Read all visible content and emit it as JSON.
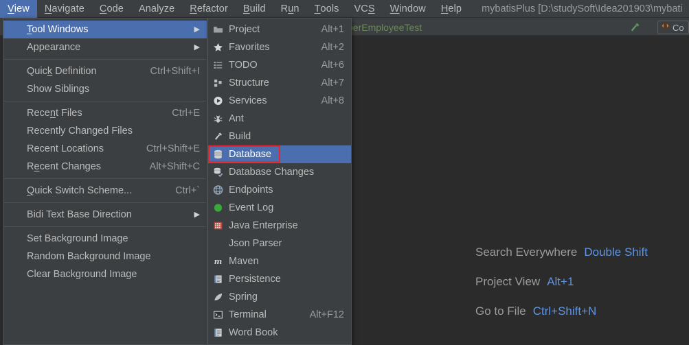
{
  "window": {
    "title": "mybatisPlus [D:\\studySoft\\Idea201903\\mybati",
    "accent_highlight": "#4b6eaf",
    "background": "#2b2b2b",
    "menu_background": "#3c3f41",
    "annotation_color": "#e8232a"
  },
  "menubar": {
    "items": [
      {
        "label": "View",
        "mnemonic": "V",
        "active": true
      },
      {
        "label": "Navigate",
        "mnemonic": "N",
        "active": false
      },
      {
        "label": "Code",
        "mnemonic": "C",
        "active": false
      },
      {
        "label": "Analyze",
        "mnemonic": "",
        "active": false
      },
      {
        "label": "Refactor",
        "mnemonic": "R",
        "active": false
      },
      {
        "label": "Build",
        "mnemonic": "B",
        "active": false
      },
      {
        "label": "Run",
        "mnemonic": "u",
        "active": false
      },
      {
        "label": "Tools",
        "mnemonic": "T",
        "active": false
      },
      {
        "label": "VCS",
        "mnemonic": "S",
        "active": false
      },
      {
        "label": "Window",
        "mnemonic": "W",
        "active": false
      },
      {
        "label": "Help",
        "mnemonic": "H",
        "active": false
      }
    ]
  },
  "editor": {
    "tab_label": "perEmployeeTest",
    "build_icon": "hammer-icon",
    "run_config_label": "Co",
    "run_config_icon": "run-config-icon"
  },
  "tips": [
    {
      "name": "Search Everywhere",
      "key": "Double Shift"
    },
    {
      "name": "Project View",
      "key": "Alt+1"
    },
    {
      "name": "Go to File",
      "key": "Ctrl+Shift+N"
    }
  ],
  "view_menu": {
    "items": [
      {
        "label": "Tool Windows",
        "mnemonic": "T",
        "accel": "",
        "submenu": true,
        "selected": true
      },
      {
        "label": "Appearance",
        "mnemonic": "",
        "accel": "",
        "submenu": true,
        "selected": false
      },
      {
        "separator": true
      },
      {
        "label": "Quick Definition",
        "mnemonic": "k",
        "accel": "Ctrl+Shift+I",
        "submenu": false,
        "selected": false
      },
      {
        "label": "Show Siblings",
        "mnemonic": "",
        "accel": "",
        "submenu": false,
        "selected": false
      },
      {
        "separator": true
      },
      {
        "label": "Recent Files",
        "mnemonic": "n",
        "accel": "Ctrl+E",
        "submenu": false,
        "selected": false
      },
      {
        "label": "Recently Changed Files",
        "mnemonic": "",
        "accel": "",
        "submenu": false,
        "selected": false
      },
      {
        "label": "Recent Locations",
        "mnemonic": "",
        "accel": "Ctrl+Shift+E",
        "submenu": false,
        "selected": false
      },
      {
        "label": "Recent Changes",
        "mnemonic": "e",
        "accel": "Alt+Shift+C",
        "submenu": false,
        "selected": false
      },
      {
        "separator": true
      },
      {
        "label": "Quick Switch Scheme...",
        "mnemonic": "Q",
        "accel": "Ctrl+`",
        "submenu": false,
        "selected": false
      },
      {
        "separator": true
      },
      {
        "label": "Bidi Text Base Direction",
        "mnemonic": "",
        "accel": "",
        "submenu": true,
        "selected": false
      },
      {
        "separator": true
      },
      {
        "label": "Set Background Image",
        "mnemonic": "",
        "accel": "",
        "submenu": false,
        "selected": false
      },
      {
        "label": "Random Background Image",
        "mnemonic": "",
        "accel": "",
        "submenu": false,
        "selected": false
      },
      {
        "label": "Clear Background Image",
        "mnemonic": "",
        "accel": "",
        "submenu": false,
        "selected": false
      }
    ]
  },
  "tool_windows_menu": {
    "items": [
      {
        "label": "Project",
        "accel": "Alt+1",
        "icon": "folder-icon",
        "selected": false
      },
      {
        "label": "Favorites",
        "accel": "Alt+2",
        "icon": "star-icon",
        "selected": false
      },
      {
        "label": "TODO",
        "accel": "Alt+6",
        "icon": "todo-list-icon",
        "selected": false
      },
      {
        "label": "Structure",
        "accel": "Alt+7",
        "icon": "structure-icon",
        "selected": false
      },
      {
        "label": "Services",
        "accel": "Alt+8",
        "icon": "services-play-icon",
        "selected": false
      },
      {
        "label": "Ant",
        "accel": "",
        "icon": "ant-bug-icon",
        "selected": false
      },
      {
        "label": "Build",
        "accel": "",
        "icon": "hammer-icon",
        "selected": false
      },
      {
        "label": "Database",
        "accel": "",
        "icon": "database-icon",
        "selected": true
      },
      {
        "label": "Database Changes",
        "accel": "",
        "icon": "database-changes-icon",
        "selected": false
      },
      {
        "label": "Endpoints",
        "accel": "",
        "icon": "globe-icon",
        "selected": false
      },
      {
        "label": "Event Log",
        "accel": "",
        "icon": "green-circle-icon",
        "selected": false
      },
      {
        "label": "Java Enterprise",
        "accel": "",
        "icon": "java-enterprise-icon",
        "selected": false
      },
      {
        "label": "Json Parser",
        "accel": "",
        "icon": "",
        "selected": false
      },
      {
        "label": "Maven",
        "accel": "",
        "icon": "maven-m-icon",
        "selected": false
      },
      {
        "label": "Persistence",
        "accel": "",
        "icon": "persistence-icon",
        "selected": false
      },
      {
        "label": "Spring",
        "accel": "",
        "icon": "spring-leaf-icon",
        "selected": false
      },
      {
        "label": "Terminal",
        "accel": "Alt+F12",
        "icon": "terminal-icon",
        "selected": false
      },
      {
        "label": "Word Book",
        "accel": "",
        "icon": "book-icon",
        "selected": false
      }
    ]
  }
}
